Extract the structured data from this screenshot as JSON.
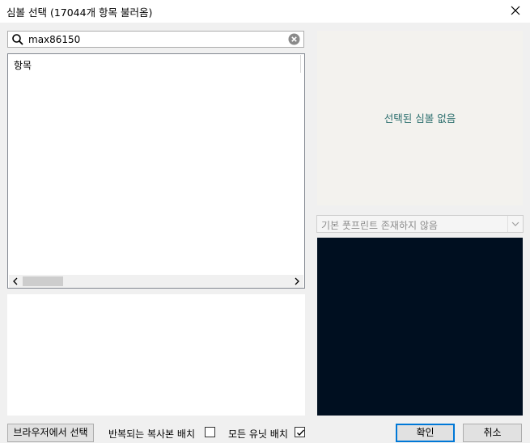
{
  "window": {
    "title": "심볼 선택 (17044개 항목 불러옴)",
    "close_icon": "close-icon"
  },
  "search": {
    "value": "max86150",
    "icon": "search-icon",
    "clear_icon": "clear-icon"
  },
  "symbol_list": {
    "header": "항목"
  },
  "preview": {
    "empty_text": "선택된 심볼 없음"
  },
  "footprint": {
    "selected": "기본 풋프린트 존재하지 않음"
  },
  "footer": {
    "browser_button": "브라우저에서 선택",
    "repeat_copies_label": "반복되는 복사본 배치",
    "repeat_copies_checked": false,
    "all_units_label": "모든 유닛 배치",
    "all_units_checked": true,
    "ok_button": "확인",
    "cancel_button": "취소"
  },
  "colors": {
    "preview_text": "#2b6e6d",
    "footprint_view_bg": "#000f20",
    "ok_border": "#0078d7"
  }
}
